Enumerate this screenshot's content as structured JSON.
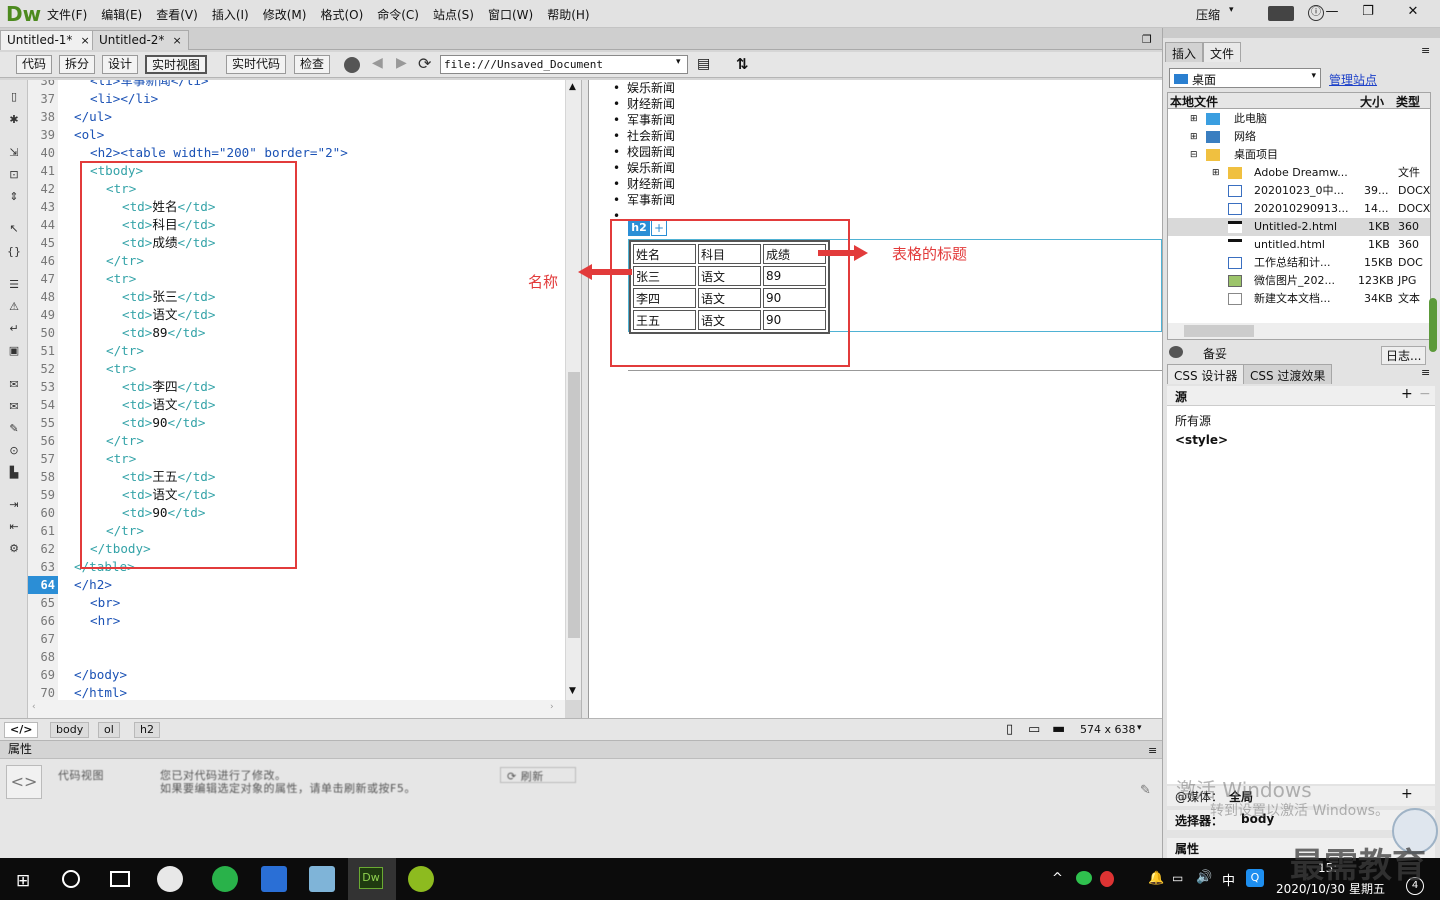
{
  "app": {
    "logo": "Dw",
    "compress_label": "压缩",
    "menu": [
      "文件(F)",
      "编辑(E)",
      "查看(V)",
      "插入(I)",
      "修改(M)",
      "格式(O)",
      "命令(C)",
      "站点(S)",
      "窗口(W)",
      "帮助(H)"
    ]
  },
  "tabs": [
    {
      "label": "Untitled-1*",
      "close": "×"
    },
    {
      "label": "Untitled-2*",
      "close": "×"
    }
  ],
  "toolbar": {
    "code": "代码",
    "split": "拆分",
    "design": "设计",
    "live_view": "实时视图",
    "live_code": "实时代码",
    "inspect": "检查",
    "address": "file:///Unsaved_Document"
  },
  "code": {
    "first_line_fragment": "<li>军事新闻</li>",
    "lines": [
      {
        "n": "36",
        "text": ""
      },
      {
        "n": "37",
        "text": ""
      },
      {
        "n": "38",
        "text": ""
      },
      {
        "n": "39",
        "text": ""
      },
      {
        "n": "40",
        "text": ""
      },
      {
        "n": "41",
        "text": ""
      },
      {
        "n": "42",
        "text": ""
      },
      {
        "n": "43",
        "text": ""
      },
      {
        "n": "44",
        "text": ""
      },
      {
        "n": "45",
        "text": ""
      },
      {
        "n": "46",
        "text": ""
      },
      {
        "n": "47",
        "text": ""
      },
      {
        "n": "48",
        "text": ""
      },
      {
        "n": "49",
        "text": ""
      },
      {
        "n": "50",
        "text": ""
      },
      {
        "n": "51",
        "text": ""
      },
      {
        "n": "52",
        "text": ""
      },
      {
        "n": "53",
        "text": ""
      },
      {
        "n": "54",
        "text": ""
      },
      {
        "n": "55",
        "text": ""
      },
      {
        "n": "56",
        "text": ""
      },
      {
        "n": "57",
        "text": ""
      },
      {
        "n": "58",
        "text": ""
      },
      {
        "n": "59",
        "text": ""
      },
      {
        "n": "60",
        "text": ""
      },
      {
        "n": "61",
        "text": ""
      },
      {
        "n": "62",
        "text": ""
      },
      {
        "n": "63",
        "text": ""
      },
      {
        "n": "64",
        "text": ""
      },
      {
        "n": "65",
        "text": ""
      },
      {
        "n": "66",
        "text": ""
      },
      {
        "n": "67",
        "text": ""
      },
      {
        "n": "68",
        "text": ""
      },
      {
        "n": "69",
        "text": ""
      },
      {
        "n": "70",
        "text": ""
      }
    ],
    "current_line": "64"
  },
  "design": {
    "news": [
      "娱乐新闻",
      "财经新闻",
      "军事新闻",
      "社会新闻",
      "校园新闻",
      "娱乐新闻",
      "财经新闻",
      "军事新闻"
    ],
    "h2_badge": "h2",
    "h2_plus": "+",
    "table": [
      [
        "姓名",
        "科目",
        "成绩"
      ],
      [
        "张三",
        "语文",
        "89"
      ],
      [
        "李四",
        "语文",
        "90"
      ],
      [
        "王五",
        "语文",
        "90"
      ]
    ],
    "annotation_left": "名称",
    "annotation_right": "表格的标题"
  },
  "statusbar": {
    "crumbs": [
      "body",
      "ol",
      "h2"
    ],
    "size": "574 x 638"
  },
  "properties": {
    "title": "属性",
    "code_view": "代码视图",
    "msg1": "您已对代码进行了修改。",
    "msg2": "如果要编辑选定对象的属性，请单击刷新或按F5。",
    "refresh": "刷新"
  },
  "panel": {
    "tabs": [
      "插入",
      "文件"
    ],
    "site": "桌面",
    "manage": "管理站点",
    "columns": [
      "本地文件",
      "大小",
      "类型"
    ],
    "files": [
      {
        "name": "此电脑",
        "size": "",
        "type": ""
      },
      {
        "name": "网络",
        "size": "",
        "type": ""
      },
      {
        "name": "桌面项目",
        "size": "",
        "type": ""
      },
      {
        "name": "Adobe Dreamw...",
        "size": "",
        "type": "文件"
      },
      {
        "name": "20201023_0中...",
        "size": "39...",
        "type": "DOCX"
      },
      {
        "name": "202010290913...",
        "size": "14...",
        "type": "DOCX"
      },
      {
        "name": "Untitled-2.html",
        "size": "1KB",
        "type": "360"
      },
      {
        "name": "untitled.html",
        "size": "1KB",
        "type": "360"
      },
      {
        "name": "工作总结和计...",
        "size": "15KB",
        "type": "DOC"
      },
      {
        "name": "微信图片_202...",
        "size": "123KB",
        "type": "JPG"
      },
      {
        "name": "新建文本文档...",
        "size": "34KB",
        "type": "文本"
      }
    ],
    "backup": "备妥",
    "log": "日志...",
    "css_tabs": [
      "CSS 设计器",
      "CSS 过渡效果"
    ],
    "source_label": "源",
    "all_sources": "所有源",
    "style_tag": "<style>",
    "media_label": "@媒体：",
    "media_value": "全局",
    "selector_label": "选择器：",
    "selector_value": "body",
    "props_label": "属性"
  },
  "watermark": "最需教育",
  "activate": {
    "line1": "激活 Windows",
    "line2": "转到设置以激活 Windows。"
  },
  "taskbar": {
    "ime": "中",
    "time": "15:",
    "date": "2020/10/30 星期五",
    "badge": "4"
  }
}
